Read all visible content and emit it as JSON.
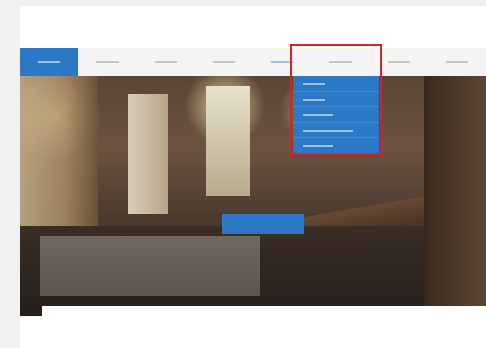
{
  "header": {
    "logo": "",
    "tagline": "",
    "contact_line_1": "",
    "contact_line_2": ""
  },
  "nav": {
    "items": [
      {
        "label": ""
      },
      {
        "label": ""
      },
      {
        "label": ""
      },
      {
        "label": ""
      },
      {
        "label": ""
      },
      {
        "label": ""
      },
      {
        "label": ""
      },
      {
        "label": ""
      }
    ],
    "active_index": 0,
    "open_index": 4
  },
  "dropdown": {
    "items": [
      {
        "label": ""
      },
      {
        "label": ""
      },
      {
        "label": ""
      },
      {
        "label": ""
      },
      {
        "label": ""
      }
    ]
  },
  "hero": {
    "headline": "",
    "button_label": ""
  },
  "colors": {
    "accent": "#2b78c6",
    "highlight": "#e02020",
    "nav_background": "#f4f4f4"
  }
}
